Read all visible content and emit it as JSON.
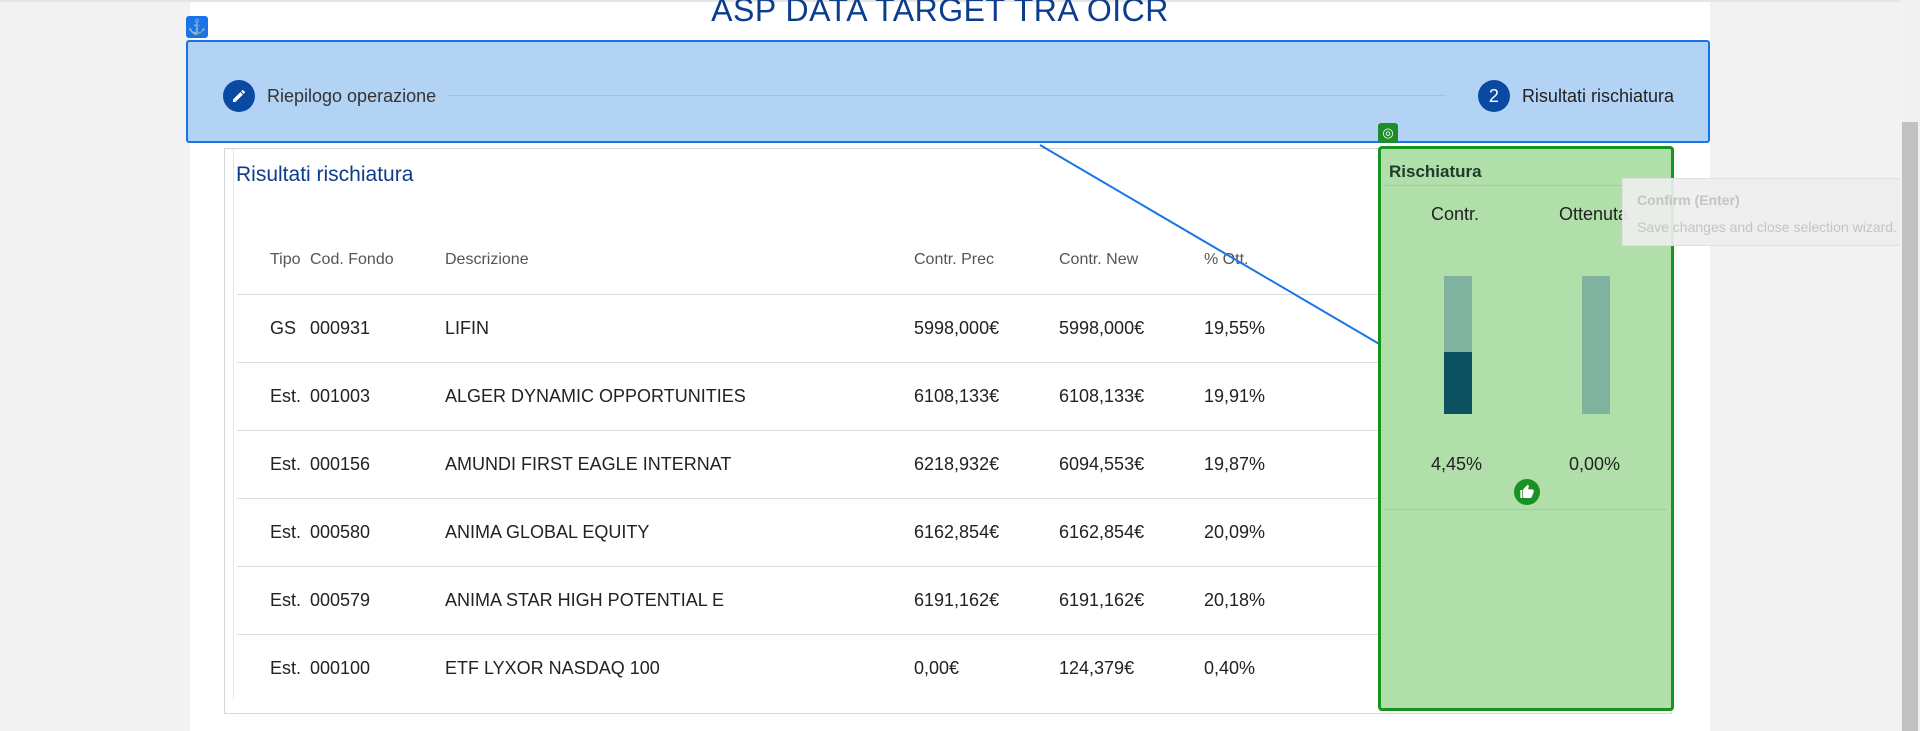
{
  "page": {
    "title": "ASP DATA TARGET TRA OICR"
  },
  "stepper": {
    "steps": [
      {
        "label": "Riepilogo operazione",
        "icon": "pencil-icon"
      },
      {
        "number": "2",
        "label": "Risultati rischiatura"
      }
    ]
  },
  "results": {
    "title": "Risultati rischiatura",
    "columns": [
      "Tipo",
      "Cod. Fondo",
      "Descrizione",
      "Contr. Prec",
      "Contr. New",
      "% Ott."
    ],
    "rows": [
      [
        "GS",
        "000931",
        "LIFIN",
        "5998,000€",
        "5998,000€",
        "19,55%"
      ],
      [
        "Est.",
        "001003",
        "ALGER DYNAMIC OPPORTUNITIES",
        "6108,133€",
        "6108,133€",
        "19,91%"
      ],
      [
        "Est.",
        "000156",
        "AMUNDI FIRST EAGLE INTERNAT",
        "6218,932€",
        "6094,553€",
        "19,87%"
      ],
      [
        "Est.",
        "000580",
        "ANIMA GLOBAL EQUITY",
        "6162,854€",
        "6162,854€",
        "20,09%"
      ],
      [
        "Est.",
        "000579",
        "ANIMA STAR HIGH POTENTIAL E",
        "6191,162€",
        "6191,162€",
        "20,18%"
      ],
      [
        "Est.",
        "000100",
        "ETF LYXOR NASDAQ 100",
        "0,00€",
        "124,379€",
        "0,40%"
      ]
    ]
  },
  "risk": {
    "title": "Rischiatura",
    "contr_label": "Contr.",
    "ott_label": "Ottenuta",
    "contr_value": "4,45%",
    "ott_value": "0,00%",
    "contr_fill_fraction": 0.45,
    "ott_fill_fraction": 0.0,
    "status_icon": "thumbs-up-icon"
  },
  "tooltip": {
    "title": "Confirm (Enter)",
    "description": "Save changes and close selection wizard."
  },
  "colors": {
    "brand": "#0b3d8c",
    "step_circle": "#0b4aa2",
    "overlay_blue": "#1a73e8",
    "overlay_green": "#17941f",
    "bar_fill": "#0b5160",
    "bar_bg": "#7fb3a0"
  }
}
